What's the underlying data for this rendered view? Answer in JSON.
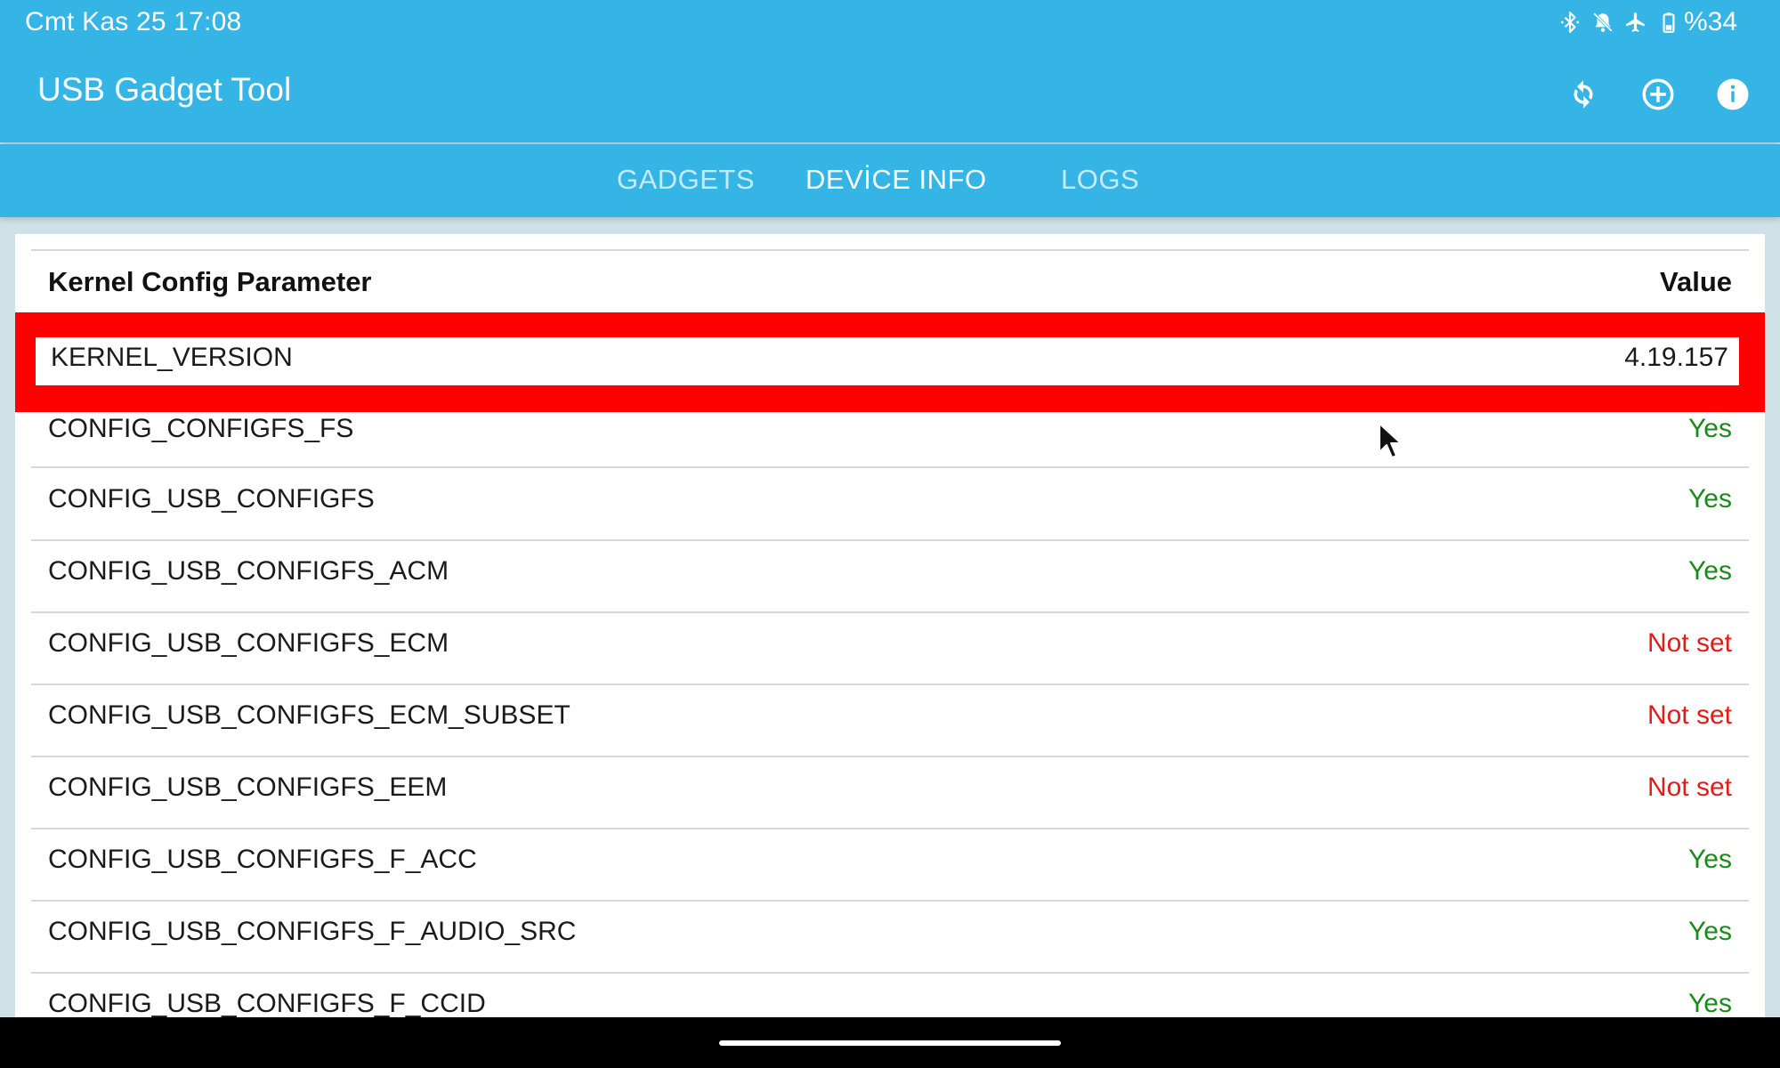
{
  "status_bar": {
    "time": "Cmt Kas 25 17:08",
    "battery_text": "%34",
    "icons": [
      "bluetooth-icon",
      "mute-icon",
      "airplane-mode-icon",
      "battery-icon"
    ]
  },
  "app_bar": {
    "title": "USB Gadget Tool",
    "actions": [
      "refresh-icon",
      "add-icon",
      "info-icon"
    ],
    "background_color": "#35b4e6"
  },
  "tabs": [
    {
      "label": "GADGETS",
      "active": false
    },
    {
      "label": "DEVİCE INFO",
      "active": true
    },
    {
      "label": "LOGS",
      "active": false
    }
  ],
  "table": {
    "header_param": "Kernel Config Parameter",
    "header_value": "Value",
    "highlight_color": "#ff0000",
    "rows": [
      {
        "param": "KERNEL_VERSION",
        "value": "4.19.157",
        "status": "plain",
        "highlighted": true
      },
      {
        "param": "CONFIG_CONFIGFS_FS",
        "value": "Yes",
        "status": "yes"
      },
      {
        "param": "CONFIG_USB_CONFIGFS",
        "value": "Yes",
        "status": "yes"
      },
      {
        "param": "CONFIG_USB_CONFIGFS_ACM",
        "value": "Yes",
        "status": "yes"
      },
      {
        "param": "CONFIG_USB_CONFIGFS_ECM",
        "value": "Not set",
        "status": "notset"
      },
      {
        "param": "CONFIG_USB_CONFIGFS_ECM_SUBSET",
        "value": "Not set",
        "status": "notset"
      },
      {
        "param": "CONFIG_USB_CONFIGFS_EEM",
        "value": "Not set",
        "status": "notset"
      },
      {
        "param": "CONFIG_USB_CONFIGFS_F_ACC",
        "value": "Yes",
        "status": "yes"
      },
      {
        "param": "CONFIG_USB_CONFIGFS_F_AUDIO_SRC",
        "value": "Yes",
        "status": "yes"
      },
      {
        "param": "CONFIG_USB_CONFIGFS_F_CCID",
        "value": "Yes",
        "status": "yes"
      }
    ],
    "status_colors": {
      "yes": "#1a8a1a",
      "notset": "#e61a1a"
    }
  }
}
